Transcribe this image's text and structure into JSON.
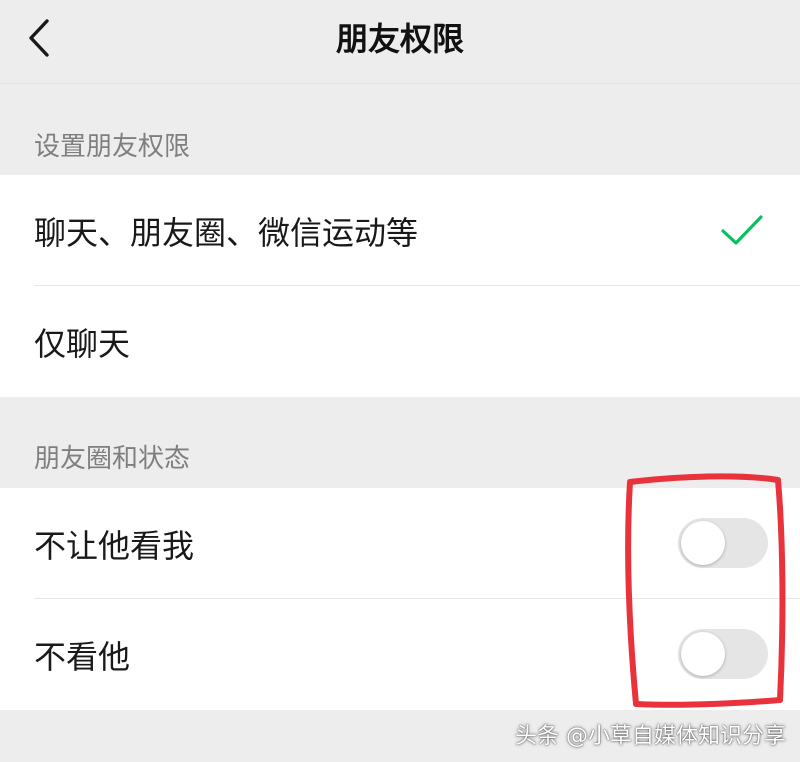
{
  "nav": {
    "title": "朋友权限",
    "back_icon": "chevron-left-icon"
  },
  "sections": {
    "permissions": {
      "header": "设置朋友权限",
      "options": [
        {
          "label": "聊天、朋友圈、微信运动等",
          "selected": true
        },
        {
          "label": "仅聊天",
          "selected": false
        }
      ]
    },
    "moments": {
      "header": "朋友圈和状态",
      "toggles": [
        {
          "label": "不让他看我",
          "on": false
        },
        {
          "label": "不看他",
          "on": false
        }
      ]
    }
  },
  "watermark": "头条 @小草自媒体知识分享",
  "colors": {
    "background": "#ededed",
    "card": "#ffffff",
    "check": "#07c160",
    "toggle_off": "#e5e5e5",
    "annotation": "#e8323c"
  }
}
